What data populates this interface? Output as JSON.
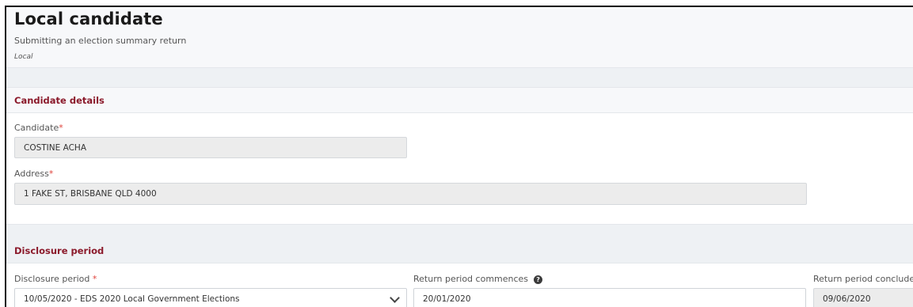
{
  "header": {
    "title": "Local candidate",
    "subtitle": "Submitting an election summary return",
    "tag": "Local"
  },
  "candidate_section": {
    "title": "Candidate details",
    "candidate_label": "Candidate",
    "candidate_value": "COSTINE ACHA",
    "address_label": "Address",
    "address_value": "1 FAKE ST, BRISBANE QLD 4000",
    "required_marker": "*"
  },
  "disclosure_section": {
    "title": "Disclosure period",
    "period_label": "Disclosure period ",
    "period_value": "10/05/2020 - EDS 2020 Local Government Elections",
    "commences_label": "Return period commences",
    "commences_value": "20/01/2020",
    "concludes_label": "Return period concludes",
    "concludes_value": "09/06/2020",
    "required_marker": "*",
    "help_icon": "question-circle-icon"
  },
  "colors": {
    "section_title": "#8b1a2b",
    "required": "#e0433c",
    "readonly_bg": "#ececec"
  }
}
